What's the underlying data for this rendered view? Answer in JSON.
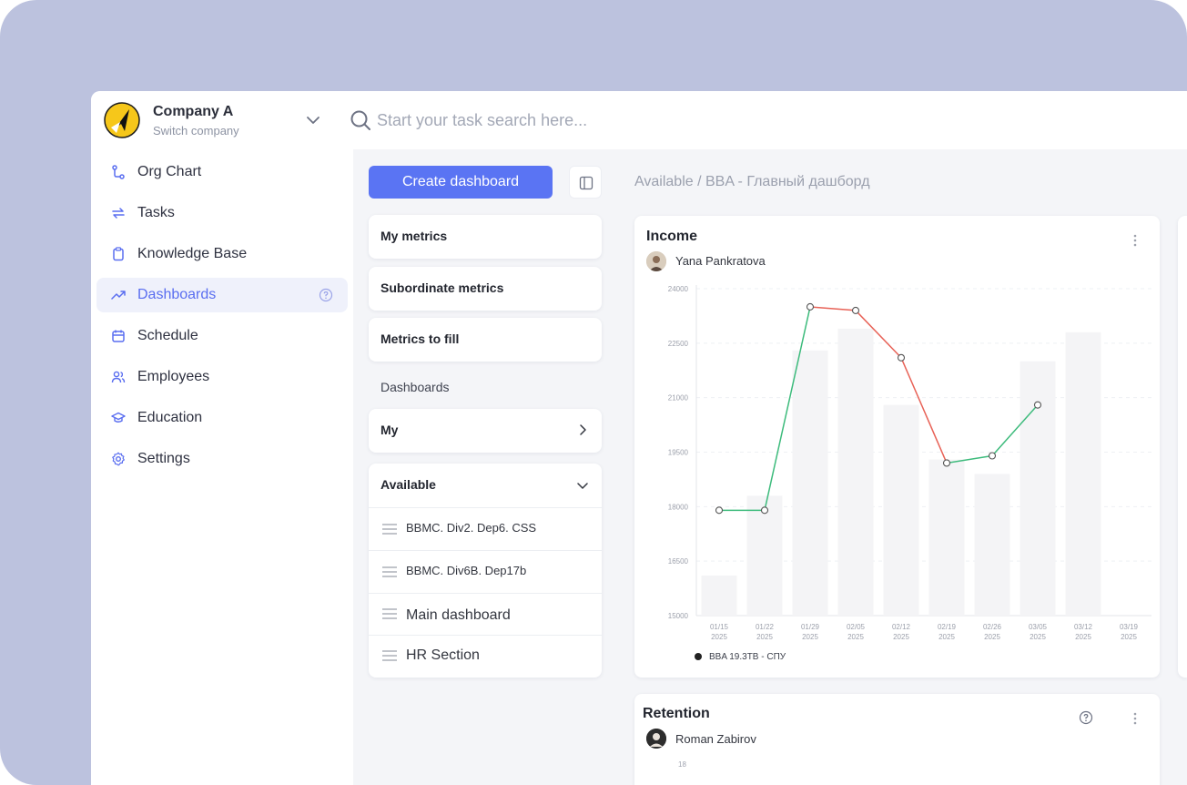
{
  "company": {
    "name": "Company A",
    "switch_label": "Switch company"
  },
  "search": {
    "placeholder": "Start your task search here..."
  },
  "sidebar": {
    "items": [
      {
        "label": "Org Chart",
        "icon": "org-chart-icon"
      },
      {
        "label": "Tasks",
        "icon": "tasks-icon"
      },
      {
        "label": "Knowledge Base",
        "icon": "clipboard-icon"
      },
      {
        "label": "Dashboards",
        "icon": "trend-icon",
        "active": true
      },
      {
        "label": "Schedule",
        "icon": "calendar-icon"
      },
      {
        "label": "Employees",
        "icon": "employees-icon"
      },
      {
        "label": "Education",
        "icon": "graduation-cap-icon"
      },
      {
        "label": "Settings",
        "icon": "gear-icon"
      }
    ]
  },
  "middle": {
    "create_button": "Create dashboard",
    "metric_cards": [
      "My metrics",
      "Subordinate metrics",
      "Metrics to fill"
    ],
    "dashboards_label": "Dashboards",
    "my_group": "My",
    "available_group": "Available",
    "available_items": [
      "BBMC. Div2. Dep6. CSS",
      "BBMC. Div6B. Dep17b",
      "Main dashboard",
      "HR Section"
    ]
  },
  "main": {
    "breadcrumb": "Available / BBA - Главный дашборд",
    "income": {
      "title": "Income",
      "owner": "Yana Pankratova",
      "legend": "BBA 19.3TB - СПУ"
    },
    "retention": {
      "title": "Retention",
      "owner": "Roman Zabirov",
      "first_tick": "18"
    }
  },
  "colors": {
    "accent": "#5a74f3",
    "up": "#3dbb7c",
    "down": "#e86257",
    "backdrop": "#bcc2de"
  },
  "chart_data": {
    "type": "line",
    "title": "Income",
    "categories": [
      "01/15 2025",
      "01/22 2025",
      "01/29 2025",
      "02/05 2025",
      "02/12 2025",
      "02/19 2025",
      "02/26 2025",
      "03/05 2025",
      "03/12 2025",
      "03/19 2025"
    ],
    "series": [
      {
        "name": "BBA 19.3TB - СПУ",
        "kind": "line",
        "values": [
          17900,
          17900,
          23500,
          23400,
          22100,
          19200,
          19400,
          20800,
          null,
          null
        ]
      },
      {
        "kind": "bar",
        "values": [
          16100,
          18300,
          22300,
          22900,
          20800,
          19300,
          18900,
          22000,
          22800,
          null
        ]
      }
    ],
    "yticks": [
      15000,
      16500,
      18000,
      19500,
      21000,
      22500,
      24000
    ],
    "ylim": [
      15000,
      24000
    ],
    "segment_colors": "green when rising, red when falling",
    "legend_position": "bottom-left",
    "grid": true
  }
}
